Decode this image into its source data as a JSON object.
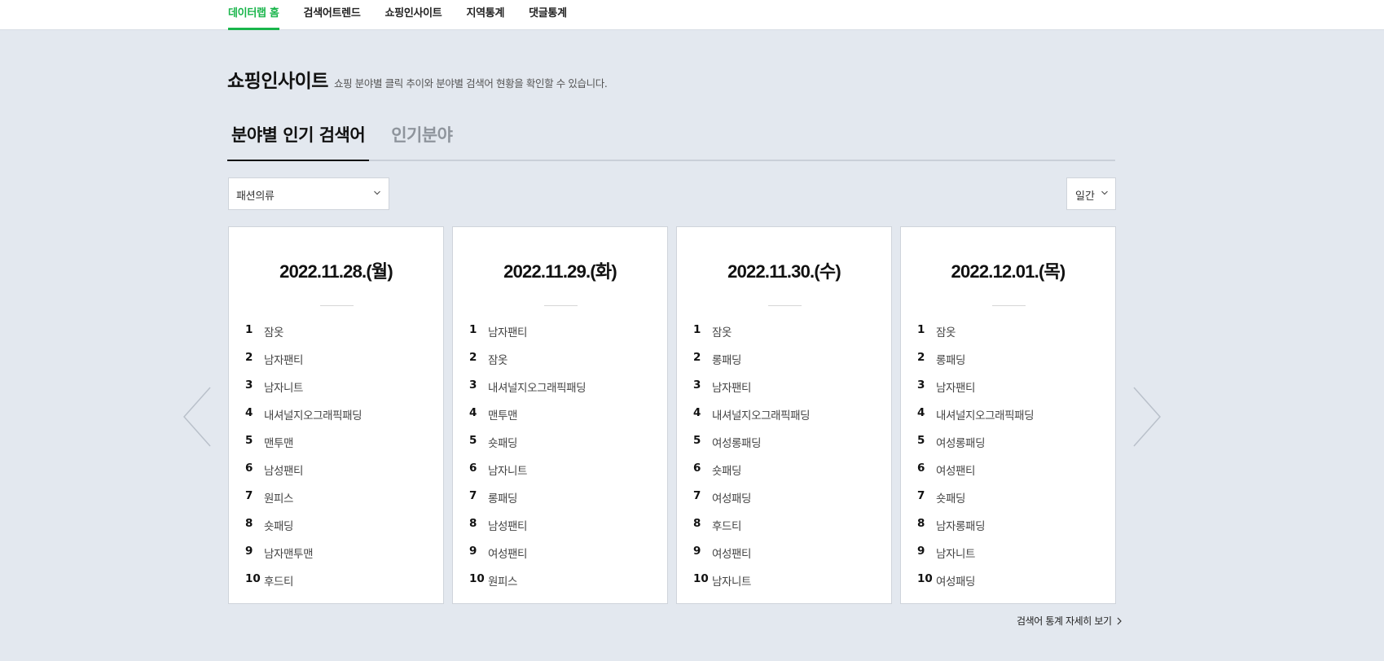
{
  "nav": {
    "items": [
      {
        "label": "데이터랩 홈",
        "active": true
      },
      {
        "label": "검색어트렌드",
        "active": false
      },
      {
        "label": "쇼핑인사이트",
        "active": false
      },
      {
        "label": "지역통계",
        "active": false
      },
      {
        "label": "댓글통계",
        "active": false
      }
    ]
  },
  "page": {
    "title": "쇼핑인사이트",
    "description": "쇼핑 분야별 클릭 추이와 분야별 검색어 현황을 확인할 수 있습니다."
  },
  "tabs": [
    {
      "label": "분야별 인기 검색어",
      "active": true
    },
    {
      "label": "인기분야",
      "active": false
    }
  ],
  "filters": {
    "category": {
      "value": "패션의류",
      "icon": "chevron-down-icon"
    },
    "period": {
      "value": "일간",
      "icon": "chevron-down-icon"
    }
  },
  "cards": [
    {
      "date": "2022.11.28.(월)",
      "ranks": [
        {
          "n": "1",
          "kw": "잠옷"
        },
        {
          "n": "2",
          "kw": "남자팬티"
        },
        {
          "n": "3",
          "kw": "남자니트"
        },
        {
          "n": "4",
          "kw": "내셔널지오그래픽패딩"
        },
        {
          "n": "5",
          "kw": "맨투맨"
        },
        {
          "n": "6",
          "kw": "남성팬티"
        },
        {
          "n": "7",
          "kw": "원피스"
        },
        {
          "n": "8",
          "kw": "숏패딩"
        },
        {
          "n": "9",
          "kw": "남자맨투맨"
        },
        {
          "n": "10",
          "kw": "후드티"
        }
      ]
    },
    {
      "date": "2022.11.29.(화)",
      "ranks": [
        {
          "n": "1",
          "kw": "남자팬티"
        },
        {
          "n": "2",
          "kw": "잠옷"
        },
        {
          "n": "3",
          "kw": "내셔널지오그래픽패딩"
        },
        {
          "n": "4",
          "kw": "맨투맨"
        },
        {
          "n": "5",
          "kw": "숏패딩"
        },
        {
          "n": "6",
          "kw": "남자니트"
        },
        {
          "n": "7",
          "kw": "롱패딩"
        },
        {
          "n": "8",
          "kw": "남성팬티"
        },
        {
          "n": "9",
          "kw": "여성팬티"
        },
        {
          "n": "10",
          "kw": "원피스"
        }
      ]
    },
    {
      "date": "2022.11.30.(수)",
      "ranks": [
        {
          "n": "1",
          "kw": "잠옷"
        },
        {
          "n": "2",
          "kw": "롱패딩"
        },
        {
          "n": "3",
          "kw": "남자팬티"
        },
        {
          "n": "4",
          "kw": "내셔널지오그래픽패딩"
        },
        {
          "n": "5",
          "kw": "여성롱패딩"
        },
        {
          "n": "6",
          "kw": "숏패딩"
        },
        {
          "n": "7",
          "kw": "여성패딩"
        },
        {
          "n": "8",
          "kw": "후드티"
        },
        {
          "n": "9",
          "kw": "여성팬티"
        },
        {
          "n": "10",
          "kw": "남자니트"
        }
      ]
    },
    {
      "date": "2022.12.01.(목)",
      "ranks": [
        {
          "n": "1",
          "kw": "잠옷"
        },
        {
          "n": "2",
          "kw": "롱패딩"
        },
        {
          "n": "3",
          "kw": "남자팬티"
        },
        {
          "n": "4",
          "kw": "내셔널지오그래픽패딩"
        },
        {
          "n": "5",
          "kw": "여성롱패딩"
        },
        {
          "n": "6",
          "kw": "여성팬티"
        },
        {
          "n": "7",
          "kw": "숏패딩"
        },
        {
          "n": "8",
          "kw": "남자롱패딩"
        },
        {
          "n": "9",
          "kw": "남자니트"
        },
        {
          "n": "10",
          "kw": "여성패딩"
        }
      ]
    }
  ],
  "carousel": {
    "prev_icon": "chevron-left-icon",
    "next_icon": "chevron-right-icon"
  },
  "footer": {
    "more_label": "검색어 통계 자세히 보기",
    "more_icon": "chevron-right-icon"
  },
  "colors": {
    "accent": "#19b54b",
    "background": "#e3e8ef"
  }
}
